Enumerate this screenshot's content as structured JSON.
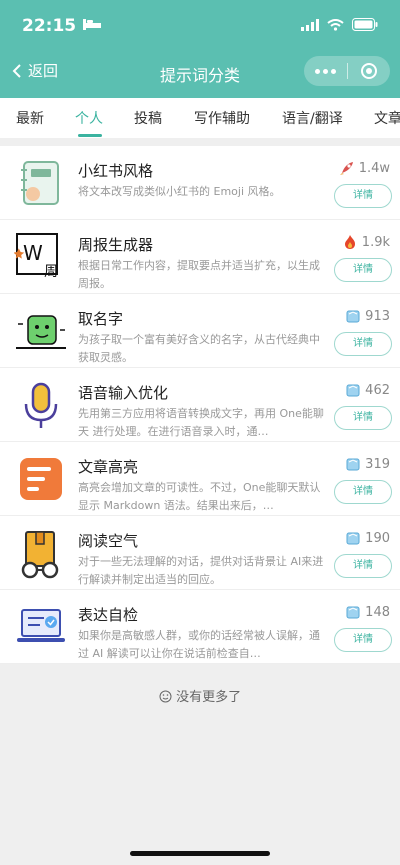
{
  "status_bar": {
    "time": "22:15"
  },
  "nav": {
    "back_label": "返回",
    "title": "提示词分类"
  },
  "tabs": [
    {
      "label": "最新",
      "active": false
    },
    {
      "label": "个人",
      "active": true
    },
    {
      "label": "投稿",
      "active": false
    },
    {
      "label": "写作辅助",
      "active": false
    },
    {
      "label": "语言/翻译",
      "active": false
    },
    {
      "label": "文章",
      "active": false
    }
  ],
  "items": [
    {
      "title": "小红书风格",
      "desc": "将文本改写成类似小红书的 Emoji 风格。",
      "count": "1.4w",
      "badge": "rocket",
      "detail": "详情"
    },
    {
      "title": "周报生成器",
      "desc": "根据日常工作内容，提取要点并适当扩充，以生成周报。",
      "count": "1.9k",
      "badge": "fire",
      "detail": "详情"
    },
    {
      "title": "取名字",
      "desc": "为孩子取一个富有美好含义的名字，从古代经典中获取灵感。",
      "count": "913",
      "badge": "ice",
      "detail": "详情"
    },
    {
      "title": "语音输入优化",
      "desc": "先用第三方应用将语音转换成文字，再用 One能聊天 进行处理。在进行语音录入时，通…",
      "count": "462",
      "badge": "ice",
      "detail": "详情"
    },
    {
      "title": "文章高亮",
      "desc": "高亮会增加文章的可读性。不过，One能聊天默认显示 Markdown 语法。结果出来后，…",
      "count": "319",
      "badge": "ice",
      "detail": "详情"
    },
    {
      "title": "阅读空气",
      "desc": "对于一些无法理解的对话，提供对话背景让 AI来进行解读并制定出适当的回应。",
      "count": "190",
      "badge": "ice",
      "detail": "详情"
    },
    {
      "title": "表达自检",
      "desc": "如果你是高敏感人群，或你的话经常被人误解，通过 AI 解读可以让你在说话前检查自…",
      "count": "148",
      "badge": "ice",
      "detail": "详情"
    }
  ],
  "footer": {
    "text": "没有更多了"
  },
  "colors": {
    "header": "#5bbfb1",
    "accent": "#3bb3a0"
  }
}
